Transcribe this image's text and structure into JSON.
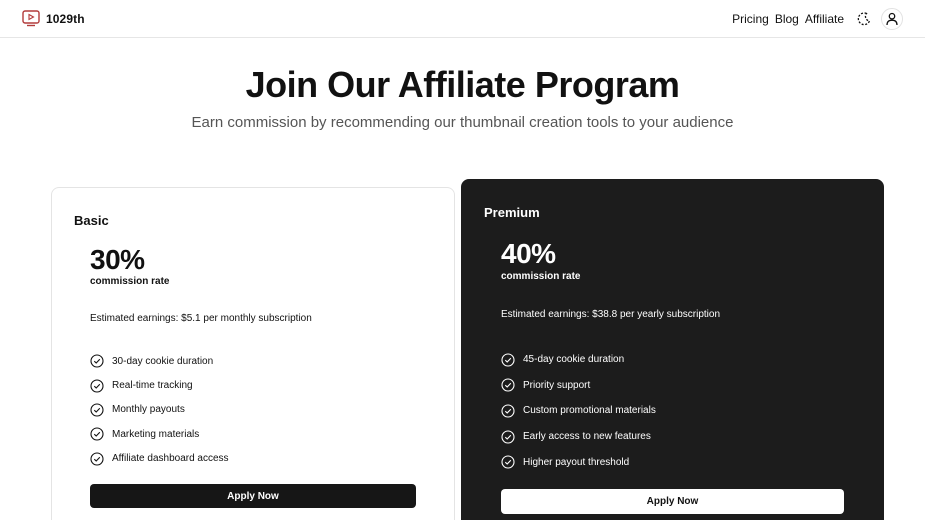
{
  "header": {
    "logo_text": "1029th",
    "logo_icon": "video-play-icon",
    "nav": [
      "Pricing",
      "Blog",
      "Affiliate"
    ],
    "theme_icon": "theme-toggle-icon",
    "user_icon": "user-icon"
  },
  "hero": {
    "title": "Join Our Affiliate Program",
    "subtitle": "Earn commission by recommending our thumbnail creation tools to your audience"
  },
  "plans": [
    {
      "name": "Basic",
      "rate": "30%",
      "rate_label": "commission rate",
      "earnings": "Estimated earnings: $5.1 per monthly subscription",
      "features": [
        "30-day cookie duration",
        "Real-time tracking",
        "Monthly payouts",
        "Marketing materials",
        "Affiliate dashboard access"
      ],
      "cta": "Apply Now"
    },
    {
      "name": "Premium",
      "rate": "40%",
      "rate_label": "commission rate",
      "earnings": "Estimated earnings: $38.8 per yearly subscription",
      "features": [
        "45-day cookie duration",
        "Priority support",
        "Custom promotional materials",
        "Early access to new features",
        "Higher payout threshold"
      ],
      "cta": "Apply Now"
    }
  ],
  "colors": {
    "text": "#111111",
    "muted": "#555555",
    "dark_card": "#1c1c1c",
    "light_button": "#ffffff",
    "dark_button": "#161616"
  }
}
